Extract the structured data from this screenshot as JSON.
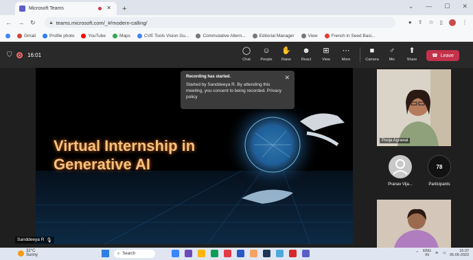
{
  "browser": {
    "tab_title": "Microsoft Teams",
    "url": "teams.microsoft.com/_#/modern-calling/",
    "bookmarks": [
      {
        "label": "Gmail",
        "color": "#d44638"
      },
      {
        "label": "Profile photo",
        "color": "#2d7ff9"
      },
      {
        "label": "YouTube",
        "color": "#ff0000"
      },
      {
        "label": "Maps",
        "color": "#34a853"
      },
      {
        "label": "CVE Tools Vision Gu...",
        "color": "#4285f4"
      },
      {
        "label": "Commutative Altern...",
        "color": "#777777"
      },
      {
        "label": "Editorial Manager",
        "color": "#777777"
      },
      {
        "label": "View",
        "color": "#777777"
      },
      {
        "label": "French in Seed Basi...",
        "color": "#e53935"
      }
    ]
  },
  "meeting": {
    "timer": "16:01",
    "toolbar": [
      {
        "label": "Chat",
        "icon": "chat-icon",
        "glyph": "◯"
      },
      {
        "label": "People",
        "icon": "people-icon",
        "glyph": "☺"
      },
      {
        "label": "Raise",
        "icon": "raise-hand-icon",
        "glyph": "✋"
      },
      {
        "label": "React",
        "icon": "react-icon",
        "glyph": "☻"
      },
      {
        "label": "View",
        "icon": "view-icon",
        "glyph": "⊞"
      },
      {
        "label": "More",
        "icon": "more-icon",
        "glyph": "⋯"
      },
      {
        "label": "Camera",
        "icon": "camera-icon",
        "glyph": "■"
      },
      {
        "label": "Mic",
        "icon": "mic-icon",
        "glyph": "♂"
      },
      {
        "label": "Share",
        "icon": "share-icon",
        "glyph": "⬆"
      }
    ],
    "leave_label": "Leave"
  },
  "toast": {
    "title": "Recording has started.",
    "body": "Started by Sanddeeya R. By attending this meeting, you consent to being recorded. Privacy policy"
  },
  "slide": {
    "line1": "Virtual Internship in",
    "line2": "Generative AI"
  },
  "presenter_name": "Sanddeeya R",
  "participants": {
    "video1_name": "Pooja Agrawal",
    "avatar_name": "Pranav Vija...",
    "count": "78",
    "count_label": "Participants"
  },
  "taskbar": {
    "weather": "32°C",
    "weather_desc": "Sunny",
    "search_placeholder": "Search",
    "lang": "ENG",
    "region": "IN",
    "time": "16:37",
    "date": "05-05-2023"
  }
}
